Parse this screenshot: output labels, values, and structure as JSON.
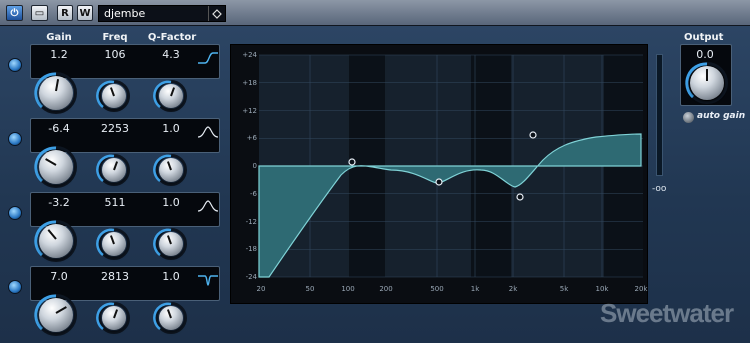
{
  "toolbar": {
    "power": "⏻",
    "bypass": "▭",
    "read": "R",
    "write": "W",
    "preset": "djembe",
    "preset_icon": "preset-menu-icon"
  },
  "headers": {
    "gain": "Gain",
    "freq": "Freq",
    "q": "Q-Factor",
    "output": "Output"
  },
  "bands": [
    {
      "gain": "1.2",
      "freq": "106",
      "q": "4.3",
      "shape": "high-shelf-icon"
    },
    {
      "gain": "-6.4",
      "freq": "2253",
      "q": "1.0",
      "shape": "bell-icon"
    },
    {
      "gain": "-3.2",
      "freq": "511",
      "q": "1.0",
      "shape": "bell-icon"
    },
    {
      "gain": "7.0",
      "freq": "2813",
      "q": "1.0",
      "shape": "notch-icon"
    }
  ],
  "graph": {
    "y_ticks": [
      "+24",
      "+18",
      "+12",
      "+6",
      "0",
      "-6",
      "-12",
      "-18",
      "-24"
    ],
    "x_ticks": [
      "20",
      "50",
      "100",
      "200",
      "500",
      "1k",
      "2k",
      "5k",
      "10k",
      "20k"
    ]
  },
  "output": {
    "value": "0.0",
    "meter_label": "-oo",
    "auto_gain": "auto gain"
  },
  "watermark": "Sweetwater",
  "colors": {
    "curve": "#7fd2d6",
    "fill": "#2f6c74",
    "panel": "#22354e"
  }
}
